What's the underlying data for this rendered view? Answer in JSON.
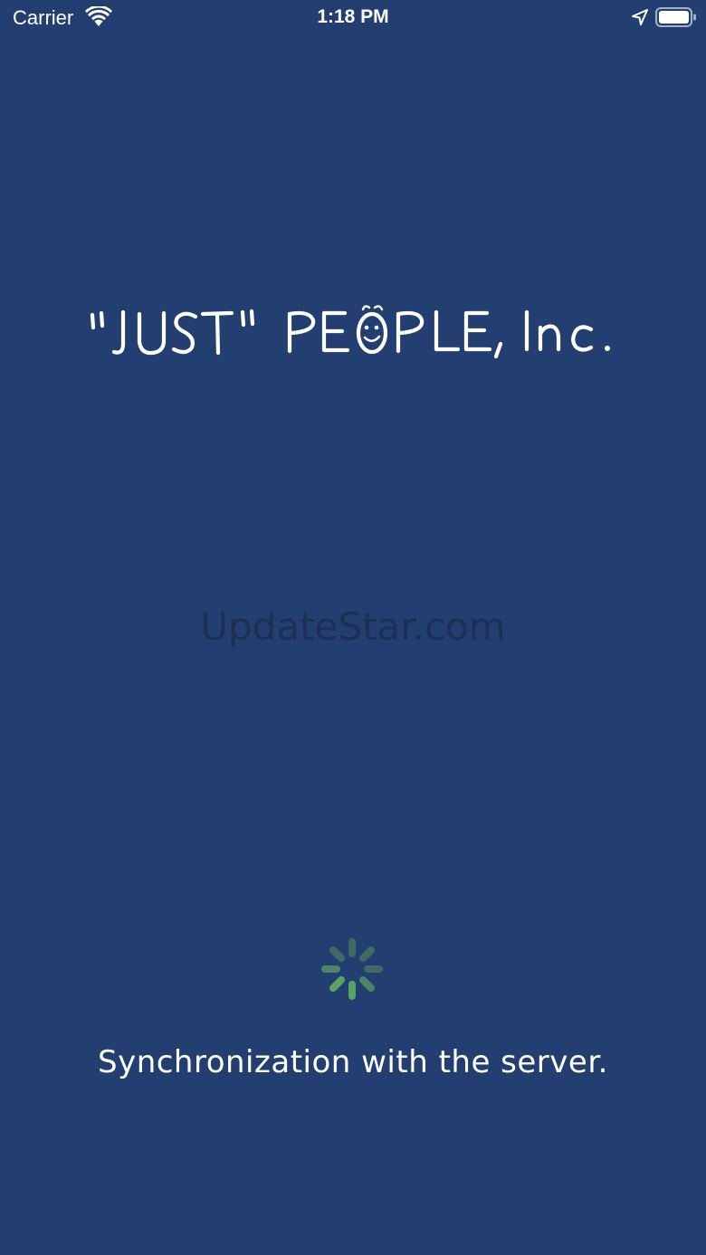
{
  "status_bar": {
    "carrier": "Carrier",
    "time": "1:18 PM",
    "wifi_icon": "wifi-icon",
    "location_icon": "location-arrow-icon",
    "battery_icon": "battery-full-icon"
  },
  "logo": {
    "text": "\"JUST\" PEOPLE, Inc.",
    "color": "#ffffff"
  },
  "watermark": {
    "text": "UpdateStar.com"
  },
  "loading": {
    "spinner_icon": "loading-spinner-icon",
    "spinner_colors": [
      "#5aa364",
      "#3f6b63"
    ],
    "message": "Synchronization with the server."
  },
  "colors": {
    "background": "#233e70"
  }
}
